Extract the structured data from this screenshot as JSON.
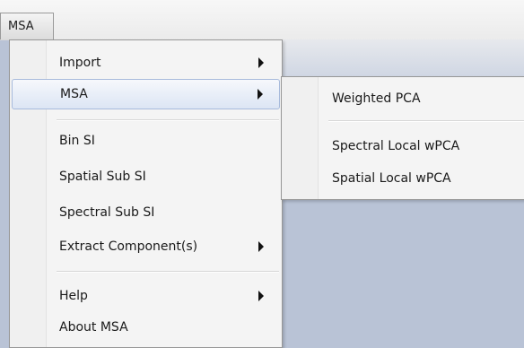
{
  "menubar": {
    "title": "MSA"
  },
  "menu": {
    "items": [
      {
        "label": "Import",
        "has_submenu": true
      },
      {
        "label": "MSA",
        "has_submenu": true,
        "active": true
      },
      {
        "label": "Bin SI"
      },
      {
        "label": "Spatial Sub SI"
      },
      {
        "label": "Spectral Sub SI"
      },
      {
        "label": "Extract Component(s)",
        "has_submenu": true
      },
      {
        "label": "Help",
        "has_submenu": true
      },
      {
        "label": "About MSA"
      }
    ]
  },
  "submenu": {
    "items": [
      {
        "label": "Weighted PCA"
      },
      {
        "label": "Spectral Local wPCA"
      },
      {
        "label": "Spatial Local wPCA"
      }
    ]
  },
  "colors": {
    "background": "#b9c3d6",
    "menu_bg": "#f4f4f4",
    "highlight_border": "#a8bbdc"
  }
}
